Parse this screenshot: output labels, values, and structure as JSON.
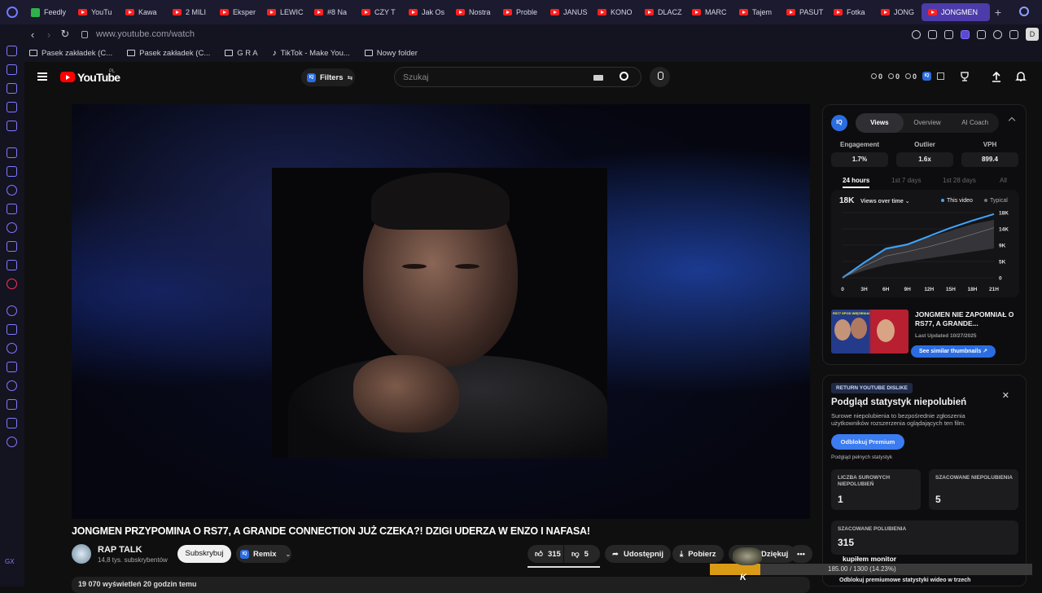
{
  "browser": {
    "tabs": [
      {
        "label": "Feedly",
        "kind": "feedly"
      },
      {
        "label": "YouTu",
        "kind": "yt"
      },
      {
        "label": "Kawa",
        "kind": "yt"
      },
      {
        "label": "2 MILI",
        "kind": "yt"
      },
      {
        "label": "Eksper",
        "kind": "yt"
      },
      {
        "label": "LEWIC",
        "kind": "yt"
      },
      {
        "label": "#8 Na",
        "kind": "yt"
      },
      {
        "label": "CZY T",
        "kind": "yt"
      },
      {
        "label": "Jak Os",
        "kind": "yt"
      },
      {
        "label": "Nostra",
        "kind": "yt"
      },
      {
        "label": "Proble",
        "kind": "yt"
      },
      {
        "label": "JANUS",
        "kind": "yt"
      },
      {
        "label": "KONO",
        "kind": "yt"
      },
      {
        "label": "DLACZ",
        "kind": "yt"
      },
      {
        "label": "MARC",
        "kind": "yt"
      },
      {
        "label": "Tajem",
        "kind": "yt"
      },
      {
        "label": "PASUT",
        "kind": "yt"
      },
      {
        "label": "Fotka",
        "kind": "yt"
      },
      {
        "label": "JONG",
        "kind": "yt"
      }
    ],
    "active_tab": "JONGMEN",
    "url": "www.youtube.com/watch",
    "profile_initial": "D",
    "bookmarks": [
      {
        "label": "Pasek zakładek (C...",
        "icon": "folder-icon"
      },
      {
        "label": "Pasek zakładek (C...",
        "icon": "folder-icon"
      },
      {
        "label": "G R A",
        "icon": "folder-icon"
      },
      {
        "label": "TikTok - Make You...",
        "icon": "tiktok-icon"
      },
      {
        "label": "Nowy folder",
        "icon": "folder-icon"
      }
    ],
    "sidebar_label": "GX"
  },
  "youtube": {
    "logo_text": "YouTube",
    "region": "PL",
    "filters_label": "Filters",
    "search_placeholder": "Szukaj",
    "counters": [
      "0",
      "0",
      "0"
    ],
    "video_title": "JONGMEN PRZYPOMINA O RS77, A GRANDE CONNECTION JUŻ CZEKA?! DZIGI UDERZA W ENZO I NAFASA!",
    "channel": {
      "name": "RAP TALK",
      "subs": "14,8 tys. subskrybentów"
    },
    "subscribe": "Subskrybuj",
    "remix": "Remix",
    "likes": "315",
    "dislikes": "5",
    "share": "Udostępnij",
    "download": "Pobierz",
    "thanks": "Dziękuj",
    "views_line": "19 070 wyświetleń  20 godzin temu"
  },
  "vidiq": {
    "logo": "IQ",
    "tabs": [
      "Views",
      "Overview",
      "AI Coach"
    ],
    "active_tab": "Views",
    "stats": [
      {
        "label": "Engagement",
        "value": "1.7%"
      },
      {
        "label": "Outlier",
        "value": "1.6x"
      },
      {
        "label": "VPH",
        "value": "899.4"
      }
    ],
    "ranges": [
      "24 hours",
      "1st 7 days",
      "1st 28 days",
      "All"
    ],
    "active_range": "24 hours",
    "chart_big": "18K",
    "chart_title": "Views over time",
    "legend_this": "This video",
    "legend_typical": "Typical",
    "similar_title": "JONGMEN NIE ZAPOMNIAŁ O RS77, A GRANDE...",
    "similar_updated": "Last Updated 10/27/2025",
    "similar_button": "See similar thumbnails ↗",
    "thumb_caption": "RS77 SPOD WIĘZIENIA!"
  },
  "chart_data": {
    "type": "line",
    "x": [
      "0",
      "3H",
      "6H",
      "9H",
      "12H",
      "15H",
      "18H",
      "21H"
    ],
    "y_ticks": [
      "0",
      "5K",
      "9K",
      "14K",
      "18K"
    ],
    "ylim": [
      0,
      18000
    ],
    "series": [
      {
        "name": "This video",
        "values": [
          0,
          4200,
          8000,
          9200,
          11500,
          13800,
          15800,
          17600
        ],
        "color": "#3ea6ff"
      },
      {
        "name": "Typical",
        "values": [
          0,
          3200,
          6000,
          7200,
          8600,
          10200,
          12000,
          13800
        ],
        "color": "#777777"
      }
    ],
    "typical_band_low": [
      0,
      2000,
      3600,
      4500,
      5400,
      6300,
      7200,
      8100
    ],
    "typical_band_high": [
      0,
      4400,
      8400,
      9500,
      11200,
      13000,
      14800,
      16000
    ]
  },
  "ryd": {
    "badge": "RETURN YOUTUBE DISLIKE",
    "title": "Podgląd statystyk niepolubień",
    "desc": "Surowe niepolubienia to bezpośrednie zgłoszenia użytkowników rozszerzenia oglądających ten film.",
    "button": "Odblokuj Premium",
    "note": "Podgląd pełnych statystyk",
    "cards": [
      {
        "label": "LICZBA SUROWYCH NIEPOLUBIEŃ",
        "value": "1"
      },
      {
        "label": "SZACOWANE NIEPOLUBIENIA",
        "value": "5"
      },
      {
        "label": "SZACOWANE POLUBIENIA",
        "value": "315"
      }
    ],
    "footer": "Odblokuj premiumowe statystyki wideo w trzech"
  },
  "overlay": {
    "text": "kupiłem monitor",
    "bar_text": "185.00 / 1300 (14.23%)",
    "progress": 0.1423,
    "logo": "K"
  }
}
